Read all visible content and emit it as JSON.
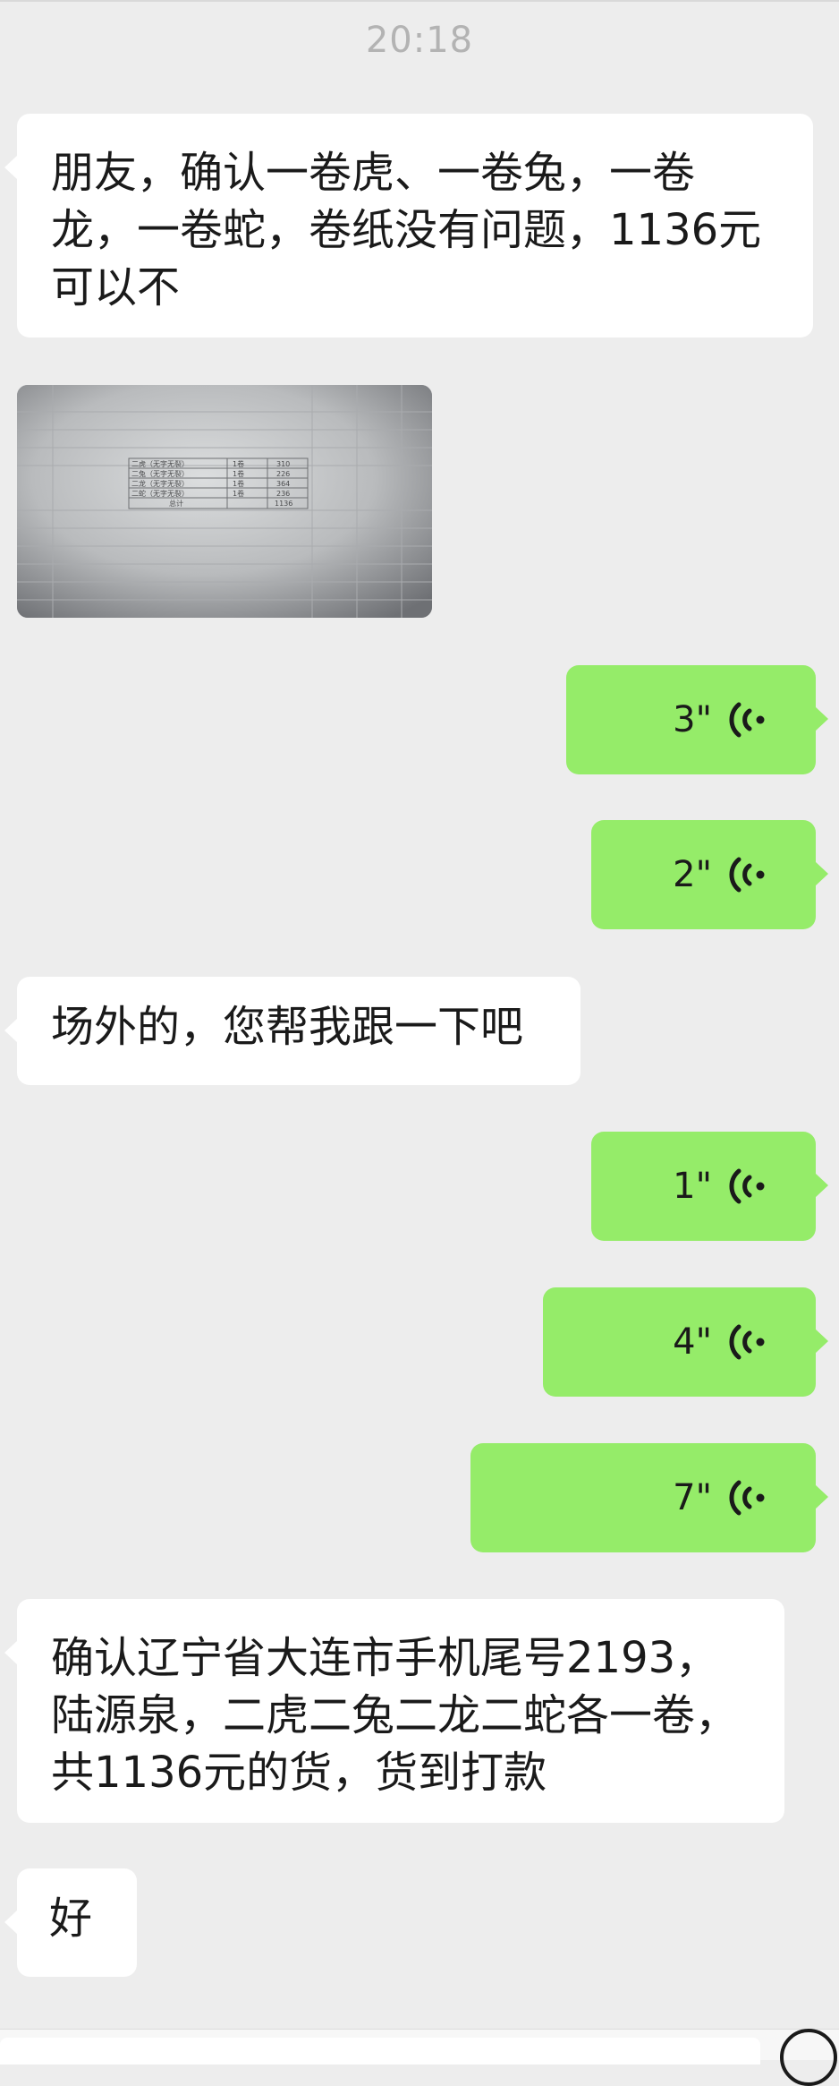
{
  "chat": {
    "timestamp": "20:18",
    "messages": [
      {
        "from": "them",
        "type": "text",
        "text": "朋友，确认一卷虎、一卷兔，一卷\n龙，一卷蛇，卷纸没有问题，1136元\n可以不"
      },
      {
        "from": "them",
        "type": "image",
        "table": {
          "rows": [
            [
              "二虎（无字无裂）",
              "1卷",
              "310"
            ],
            [
              "二兔（无字无裂）",
              "1卷",
              "226"
            ],
            [
              "二龙（无字无裂）",
              "1卷",
              "364"
            ],
            [
              "二蛇（无字无裂）",
              "1卷",
              "236"
            ]
          ],
          "total_label": "总计",
          "total_value": "1136"
        }
      },
      {
        "from": "me",
        "type": "voice",
        "duration": "3\""
      },
      {
        "from": "me",
        "type": "voice",
        "duration": "2\""
      },
      {
        "from": "them",
        "type": "text",
        "text": "场外的，您帮我跟一下吧"
      },
      {
        "from": "me",
        "type": "voice",
        "duration": "1\""
      },
      {
        "from": "me",
        "type": "voice",
        "duration": "4\""
      },
      {
        "from": "me",
        "type": "voice",
        "duration": "7\""
      },
      {
        "from": "them",
        "type": "text",
        "text": "确认辽宁省大连市手机尾号2193，\n陆源泉，二虎二兔二龙二蛇各一卷，\n共1136元的货，货到打款"
      },
      {
        "from": "them",
        "type": "text",
        "text": "好"
      }
    ]
  },
  "colors": {
    "background": "#ededed",
    "incoming_bubble": "#ffffff",
    "outgoing_bubble": "#95ec69",
    "timestamp": "#b3b3b3"
  },
  "icons": {
    "voice_wave": "voice-wave-icon",
    "voice_toggle": "voice-input-icon"
  }
}
